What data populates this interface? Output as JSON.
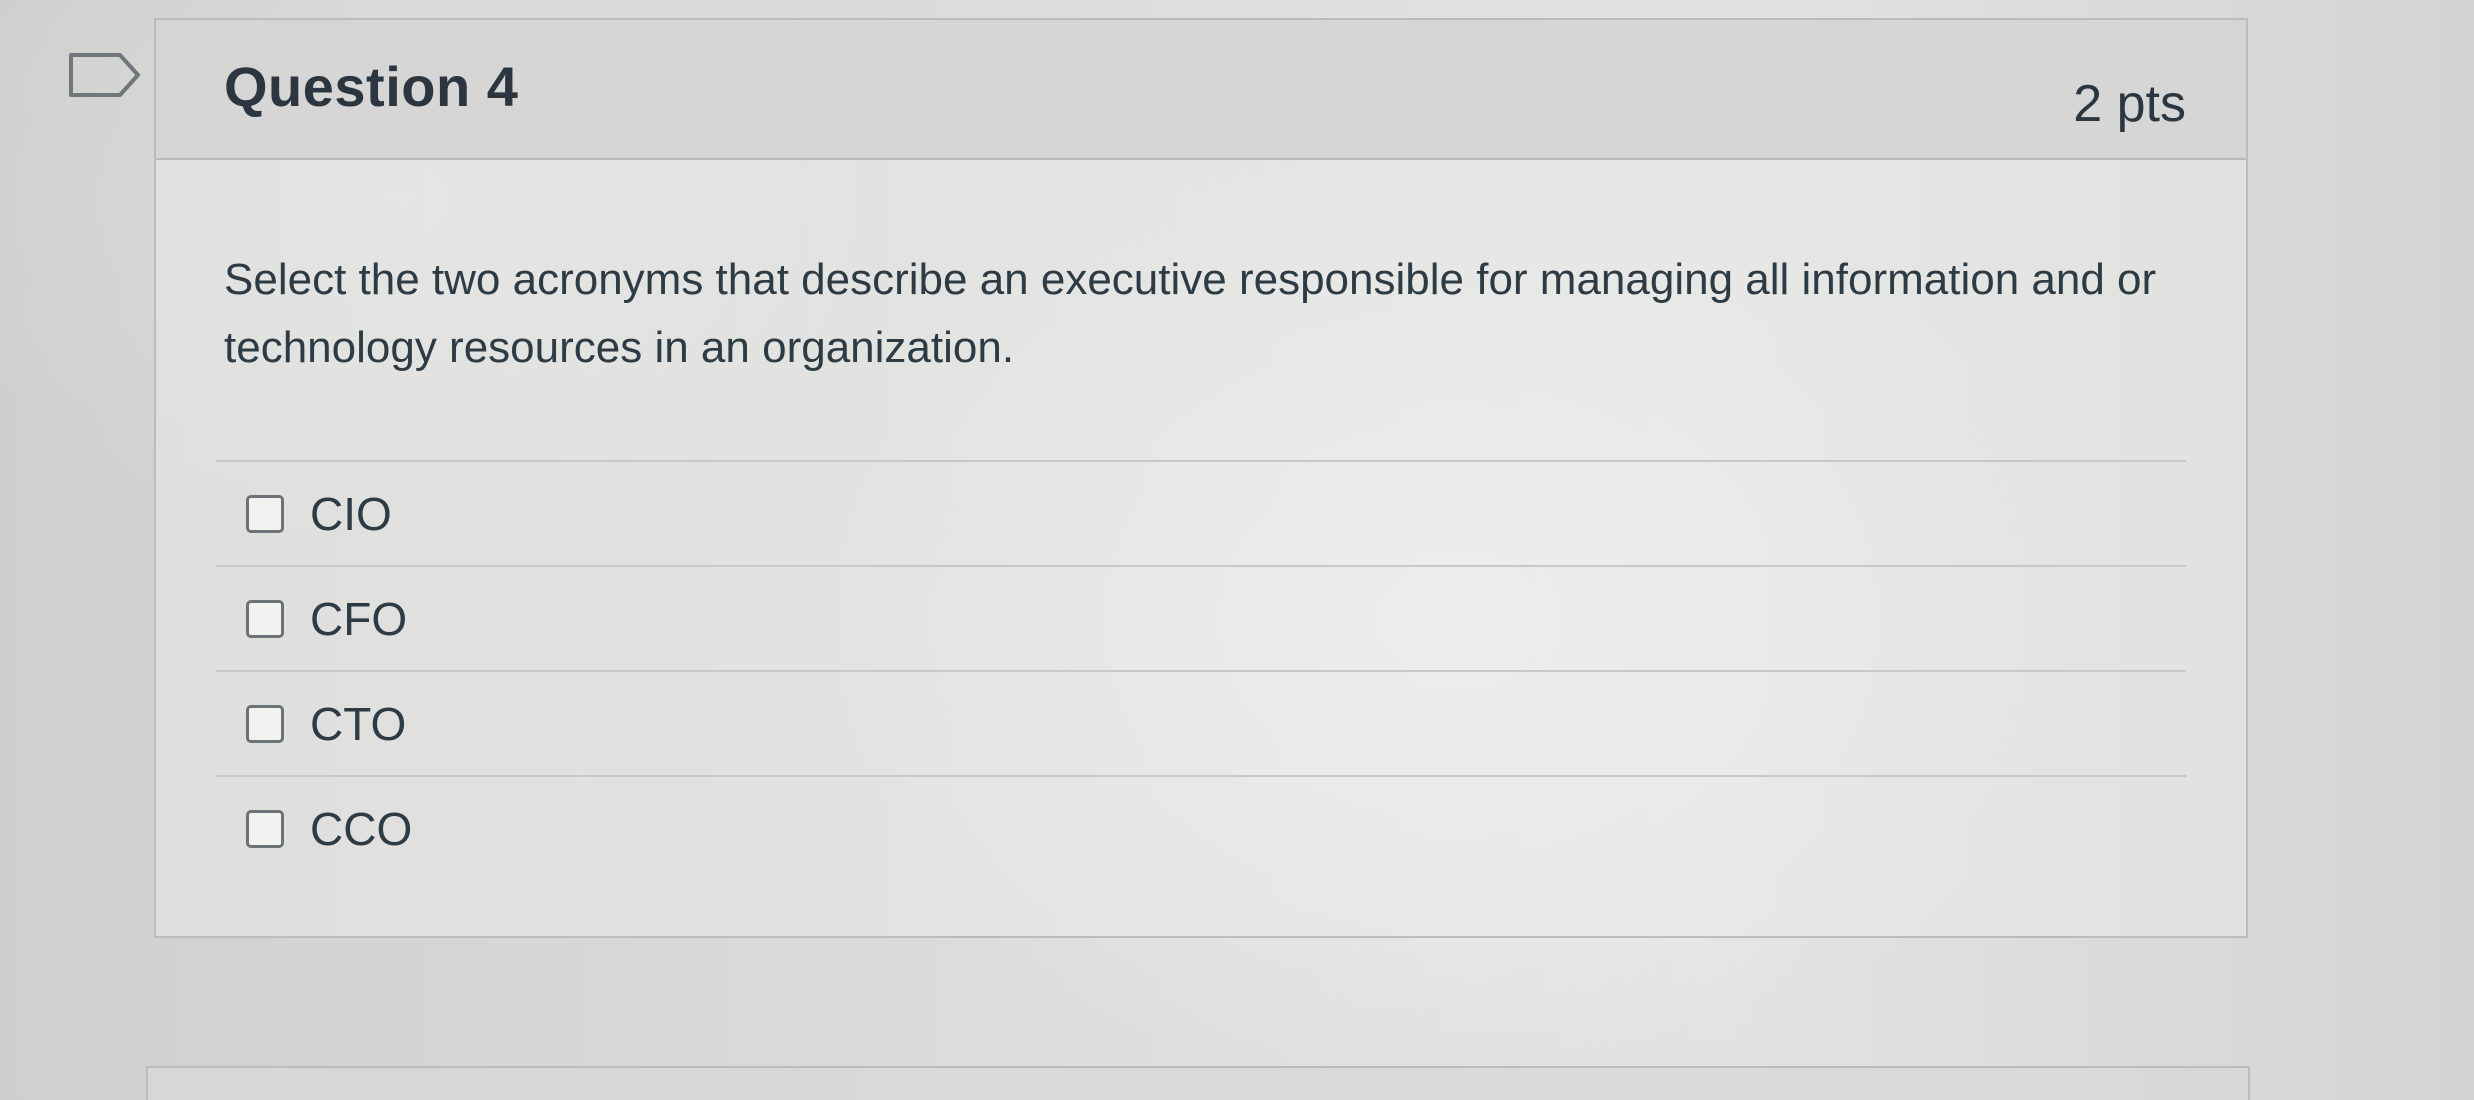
{
  "question": {
    "title": "Question 4",
    "points": "2 pts",
    "text": "Select the two acronyms that describe an executive responsible for managing all information and or technology resources in an organization.",
    "flag_icon": "flag-icon"
  },
  "answers": [
    {
      "label": "CIO",
      "checked": false
    },
    {
      "label": "CFO",
      "checked": false
    },
    {
      "label": "CTO",
      "checked": false
    },
    {
      "label": "CCO",
      "checked": false
    }
  ],
  "colors": {
    "text": "#2d3b45",
    "header_bg": "#d2d3d2",
    "border": "#b9bdbf"
  }
}
